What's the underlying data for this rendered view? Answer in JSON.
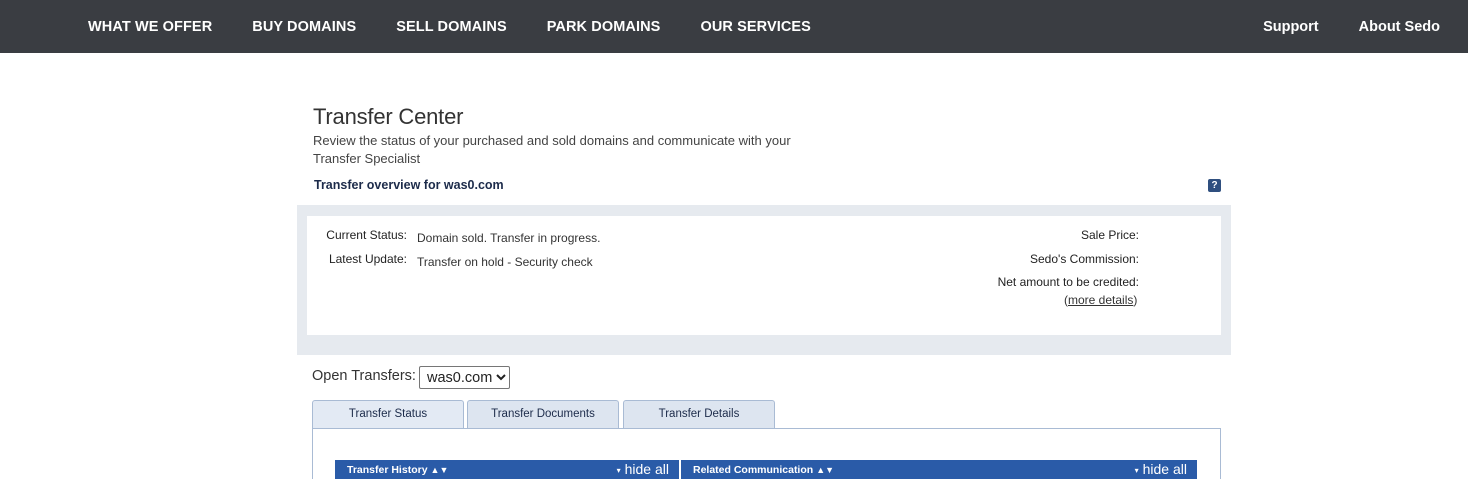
{
  "nav": {
    "left": [
      "WHAT WE OFFER",
      "BUY DOMAINS",
      "SELL DOMAINS",
      "PARK DOMAINS",
      "OUR SERVICES"
    ],
    "right": [
      "Support",
      "About Sedo"
    ]
  },
  "header": {
    "title": "Transfer Center",
    "subtitle": "Review the status of your purchased and sold domains and communicate with your Transfer Specialist",
    "overview": "Transfer overview for was0.com",
    "help": "?"
  },
  "status": {
    "current_status_label": "Current Status:",
    "current_status_value": "Domain sold. Transfer in progress.",
    "latest_update_label": "Latest Update:",
    "latest_update_value": "Transfer on hold - Security check",
    "sale_price_label": "Sale Price:",
    "commission_label": "Sedo's Commission:",
    "net_amount_label": "Net amount to be credited:",
    "more_details_open": "(",
    "more_details_link": "more details",
    "more_details_close": ")"
  },
  "open_transfers": {
    "label": "Open Transfers:",
    "selected": "was0.com"
  },
  "tabs": [
    "Transfer Status",
    "Transfer Documents",
    "Transfer Details"
  ],
  "sections": {
    "history": {
      "title": "Transfer History",
      "sort": "▲▼",
      "hide": "hide all",
      "chevron": "▾"
    },
    "communication": {
      "title": "Related Communication",
      "sort": "▲▼",
      "hide": "hide all",
      "chevron": "▾"
    }
  },
  "colors": {
    "nav_bg": "#3a3d42",
    "panel_bg": "#e6eaef",
    "section_blue": "#2a5ba8"
  }
}
